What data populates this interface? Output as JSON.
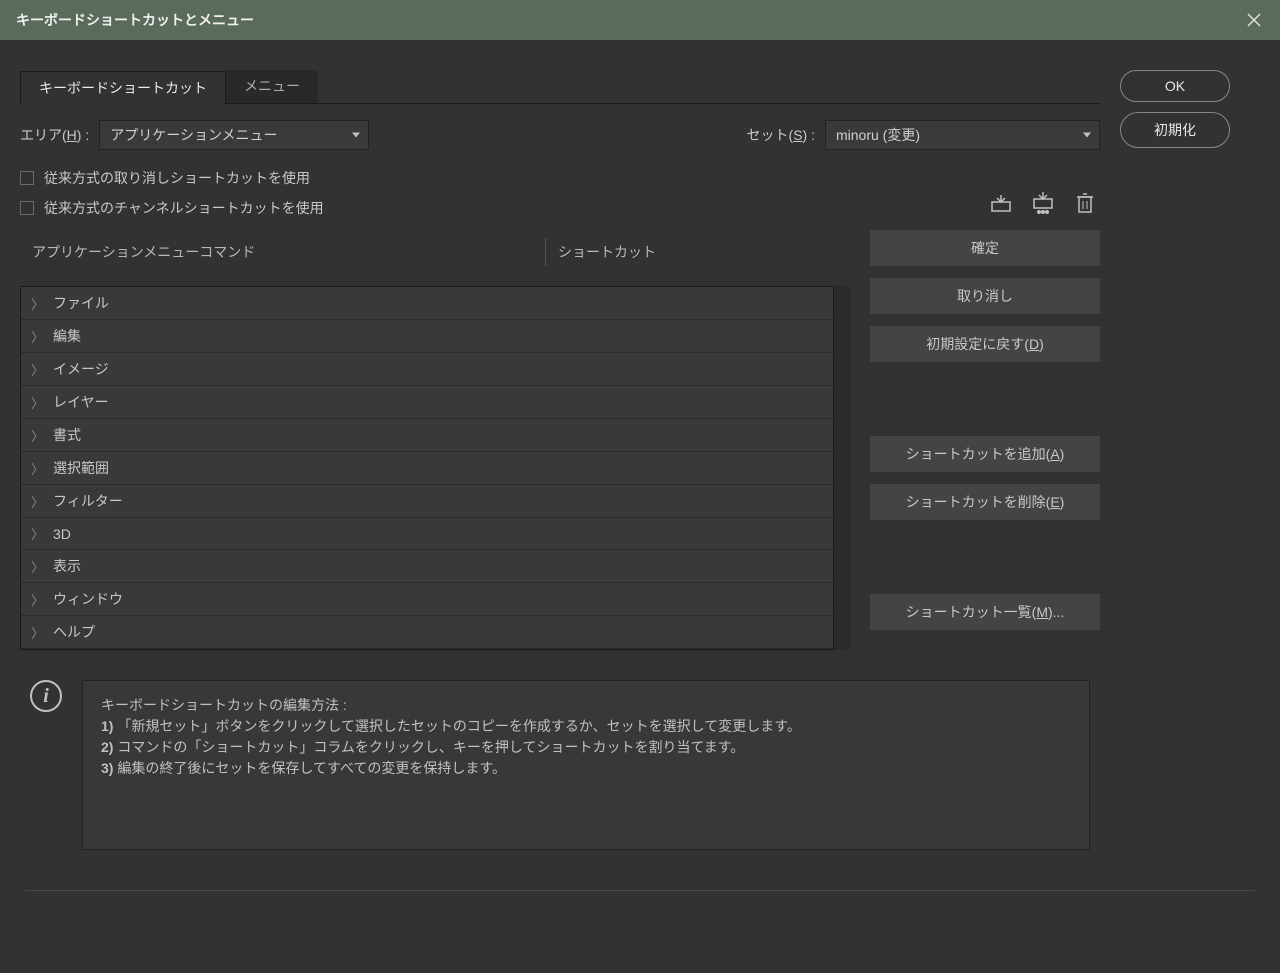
{
  "title": "キーボードショートカットとメニュー",
  "tabs": {
    "shortcuts": "キーボードショートカット",
    "menus": "メニュー"
  },
  "area": {
    "label_prefix": "エリア(",
    "label_key": "H",
    "label_suffix": ") :",
    "value": "アプリケーションメニュー"
  },
  "set": {
    "label_prefix": "セット(",
    "label_key": "S",
    "label_suffix": ") :",
    "value": "minoru (変更)"
  },
  "checkboxes": {
    "undo": "従来方式の取り消しショートカットを使用",
    "channel": "従来方式のチャンネルショートカットを使用"
  },
  "toolbar": {
    "save_as": "save-as-icon",
    "save": "save-icon",
    "delete": "delete-icon"
  },
  "columns": {
    "command": "アプリケーションメニューコマンド",
    "shortcut": "ショートカット"
  },
  "tree": [
    "ファイル",
    "編集",
    "イメージ",
    "レイヤー",
    "書式",
    "選択範囲",
    "フィルター",
    "3D",
    "表示",
    "ウィンドウ",
    "ヘルプ"
  ],
  "buttons": {
    "ok": "OK",
    "reset": "初期化",
    "confirm": "確定",
    "cancel": "取り消し",
    "defaults": "初期設定に戻す(D)",
    "add": "ショートカットを追加(A)",
    "delete": "ショートカットを削除(E)",
    "summary": "ショートカット一覧(M)..."
  },
  "info": {
    "heading": "キーボードショートカットの編集方法 :",
    "l1b": "1)",
    "l1": " 「新規セット」ボタンをクリックして選択したセットのコピーを作成するか、セットを選択して変更します。",
    "l2b": "2)",
    "l2": " コマンドの「ショートカット」コラムをクリックし、キーを押してショートカットを割り当てます。",
    "l3b": "3)",
    "l3": " 編集の終了後にセットを保存してすべての変更を保持します。"
  }
}
